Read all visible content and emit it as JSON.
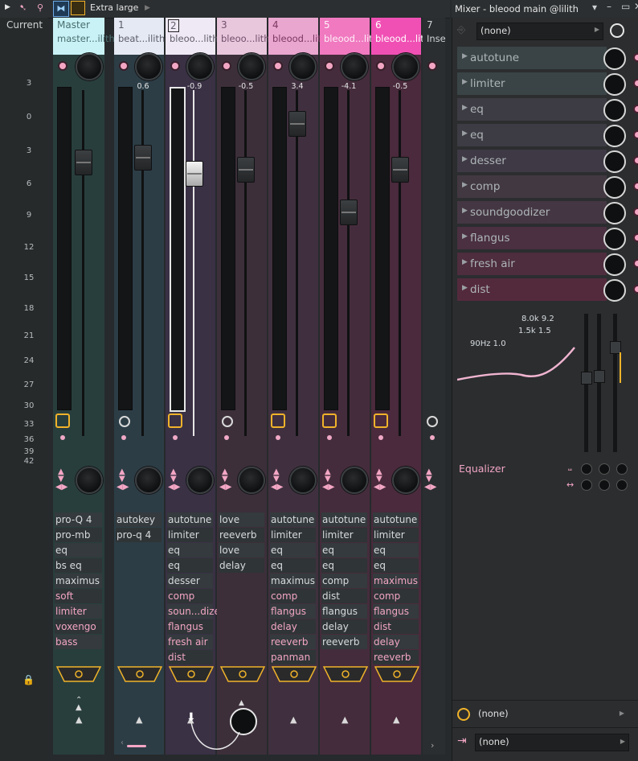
{
  "toolbar": {
    "zoom_label": "Extra large"
  },
  "mixer": {
    "title": "Mixer - bleood main @lilith"
  },
  "meter": {
    "label": "Current",
    "scale": [
      "3",
      "0",
      "3",
      "6",
      "9",
      "12",
      "15",
      "18",
      "21",
      "24",
      "27",
      "30",
      "33",
      "36",
      "39",
      "42"
    ]
  },
  "channels": [
    {
      "num": "Master",
      "name": "master...ilith",
      "vol": "",
      "fx": [
        "pro-Q 4",
        "pro-mb",
        "eq",
        "bs eq",
        "maximus",
        "soft clipper",
        "limiter",
        "voxengo",
        "bass"
      ]
    },
    {
      "num": "1",
      "name": "beat...ilith",
      "vol": "0.6",
      "fx": [
        "autokey",
        "pro-q 4"
      ]
    },
    {
      "num": "2",
      "name": "bleoo...lith",
      "vol": "-0.9",
      "fx": [
        "autotune",
        "limiter",
        "eq",
        "eq",
        "desser",
        "comp",
        "soun...dizer",
        "flangus",
        "fresh air",
        "dist"
      ]
    },
    {
      "num": "3",
      "name": "bleoo...lith",
      "vol": "-0.5",
      "fx": [
        "love filter",
        "reeverb",
        "love filter",
        "delay"
      ]
    },
    {
      "num": "4",
      "name": "bleood...lith",
      "vol": "3.4",
      "fx": [
        "autotune",
        "limiter",
        "eq",
        "eq",
        "maximus",
        "comp",
        "flangus",
        "delay",
        "reeverb",
        "panman"
      ]
    },
    {
      "num": "5",
      "name": "bleood...lith",
      "vol": "-4.1",
      "fx": [
        "autotune",
        "limiter",
        "eq",
        "eq",
        "comp",
        "dist",
        "flangus",
        "delay",
        "reeverb"
      ]
    },
    {
      "num": "6",
      "name": "bleood...lith",
      "vol": "-0.5",
      "fx": [
        "autotune",
        "limiter",
        "eq",
        "eq",
        "maximus",
        "comp",
        "flangus",
        "dist",
        "delay",
        "reeverb"
      ]
    },
    {
      "num": "7",
      "name": "Inse",
      "vol": "",
      "fx": []
    }
  ],
  "panel": {
    "input_select": "(none)",
    "slots": [
      "autotune",
      "limiter",
      "eq",
      "eq",
      "desser",
      "comp",
      "soundgoodizer",
      "flangus",
      "fresh air",
      "dist"
    ],
    "eq_labels": {
      "band_low": "90Hz 1.0",
      "band_mid": "1.5k 1.5",
      "band_high": "8.0k 9.2"
    },
    "eq_title": "Equalizer",
    "out_clock_select": "(none)",
    "output_select": "(none)"
  },
  "colors": {
    "accent_pink": "#f3a6c4",
    "accent_orange": "#f0b32a",
    "selected_pink": "#f050b4"
  }
}
